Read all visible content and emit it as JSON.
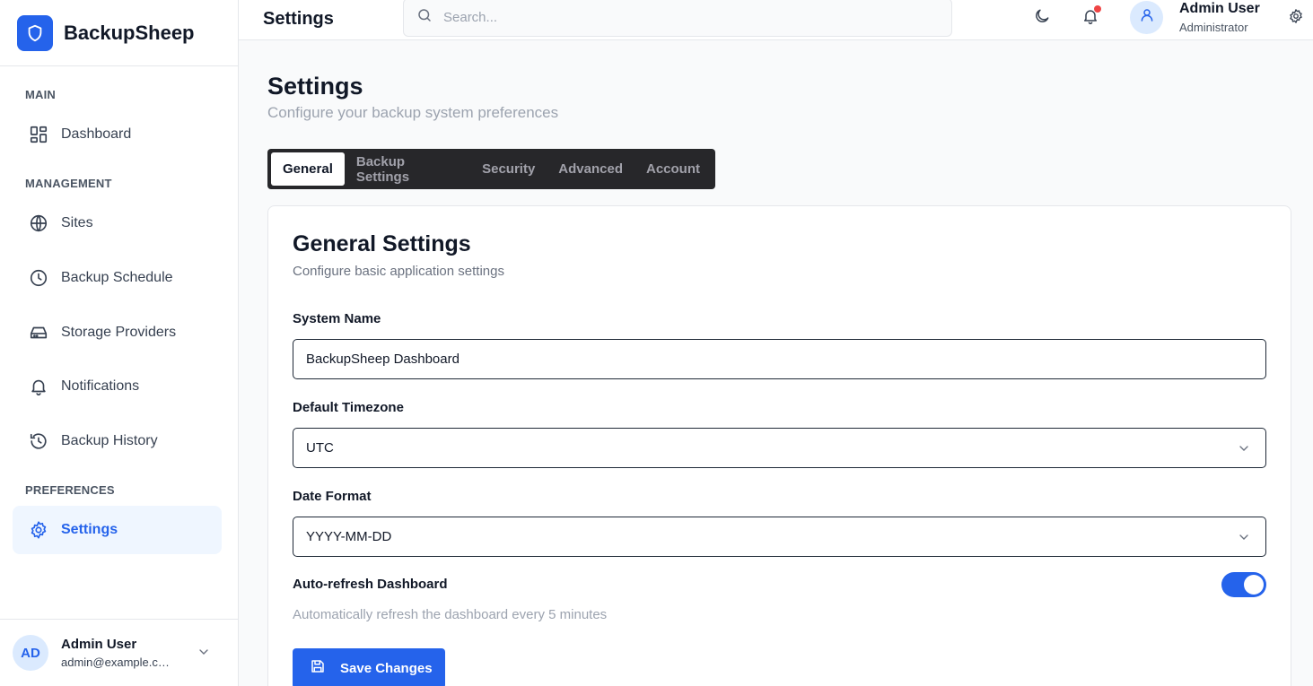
{
  "brand": {
    "name": "BackupSheep"
  },
  "sidebar": {
    "sections": [
      {
        "label": "MAIN"
      },
      {
        "label": "MANAGEMENT"
      },
      {
        "label": "PREFERENCES"
      }
    ],
    "items": [
      {
        "label": "Dashboard",
        "icon": "dashboard-grid-icon"
      },
      {
        "label": "Sites",
        "icon": "globe-icon"
      },
      {
        "label": "Backup Schedule",
        "icon": "clock-icon"
      },
      {
        "label": "Storage Providers",
        "icon": "hard-drive-icon"
      },
      {
        "label": "Notifications",
        "icon": "bell-icon"
      },
      {
        "label": "Backup History",
        "icon": "history-icon"
      },
      {
        "label": "Settings",
        "icon": "gear-icon",
        "active": true
      }
    ],
    "user": {
      "initials": "AD",
      "name": "Admin User",
      "email": "admin@example.com"
    }
  },
  "header": {
    "title": "Settings",
    "search_placeholder": "Search...",
    "user": {
      "name": "Admin User",
      "role": "Administrator"
    }
  },
  "page": {
    "title": "Settings",
    "subtitle": "Configure your backup system preferences"
  },
  "tabs": [
    {
      "label": "General",
      "active": true
    },
    {
      "label": "Backup Settings"
    },
    {
      "label": "Security"
    },
    {
      "label": "Advanced"
    },
    {
      "label": "Account"
    }
  ],
  "general": {
    "title": "General Settings",
    "subtitle": "Configure basic application settings",
    "system_name": {
      "label": "System Name",
      "value": "BackupSheep Dashboard"
    },
    "timezone": {
      "label": "Default Timezone",
      "value": "UTC"
    },
    "date_format": {
      "label": "Date Format",
      "value": "YYYY-MM-DD"
    },
    "auto_refresh": {
      "label": "Auto-refresh Dashboard",
      "enabled": true,
      "help": "Automatically refresh the dashboard every 5 minutes"
    },
    "save_label": "Save Changes"
  },
  "colors": {
    "accent": "#2563eb",
    "notification_dot": "#ef4444",
    "tabs_bg": "#27272a"
  }
}
